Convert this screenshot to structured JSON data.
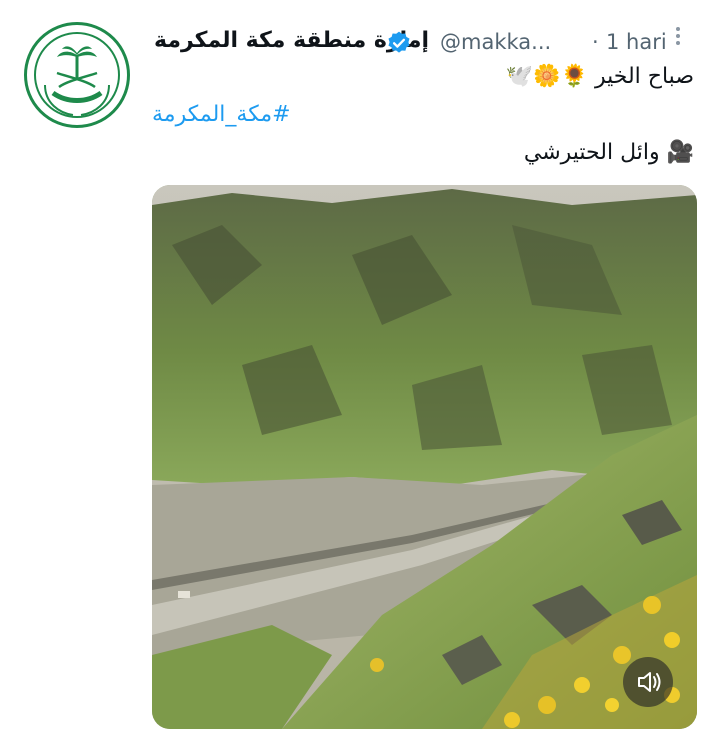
{
  "tweet": {
    "author_name": "إمارة منطقة مكة المكرمة",
    "handle": "@makka...",
    "separator": "·",
    "time": "1 hari",
    "line1_text": "صباح الخير",
    "line1_emojis": "🌻🌼🕊️",
    "hashtag": "#مكة_المكرمة",
    "line3_icon": "🎥",
    "line3_text": "وائل الحتيرشي"
  },
  "icons": {
    "verified": "verified-badge-icon",
    "more": "more-options-icon",
    "sound": "sound-icon",
    "camera": "video-camera-icon"
  },
  "colors": {
    "link": "#1d9bf0",
    "verified": "#1d9bf0",
    "meta": "#536471",
    "emblem_green": "#1e8a4b"
  }
}
